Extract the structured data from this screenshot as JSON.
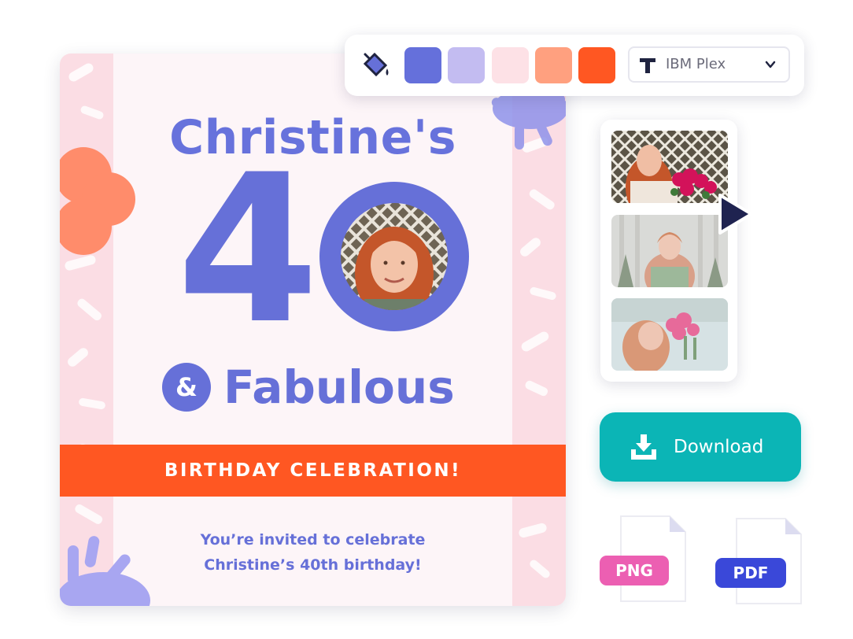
{
  "card": {
    "title_name": "Christine's",
    "big_digit": "4",
    "amp": "&",
    "fabulous": "Fabulous",
    "banner": "BIRTHDAY CELEBRATION!",
    "invite_line1": "You’re invited to celebrate",
    "invite_line2": "Christine’s 40th birthday!"
  },
  "toolbar": {
    "swatches": [
      "#6570db",
      "#c3bcf1",
      "#fde1e6",
      "#ffa07f",
      "#ff5722"
    ],
    "font_icon": "text-T-icon",
    "font_name": "IBM Plex",
    "dropdown_icon": "chevron-down-icon",
    "bucket_icon": "paint-bucket-icon"
  },
  "video_strip": {
    "thumbnails": [
      "thumbnail-flowers",
      "thumbnail-portrait",
      "thumbnail-smelling-flowers"
    ],
    "play_icon": "play-icon"
  },
  "download": {
    "label": "Download",
    "icon": "download-tray-icon"
  },
  "formats": [
    {
      "label": "PNG",
      "color": "#ec5fb2"
    },
    {
      "label": "PDF",
      "color": "#3a48d9"
    }
  ],
  "colors": {
    "primary": "#6670d8",
    "accent": "#ff5722",
    "teal": "#0bb5b6",
    "stripe": "#fbdde4"
  }
}
